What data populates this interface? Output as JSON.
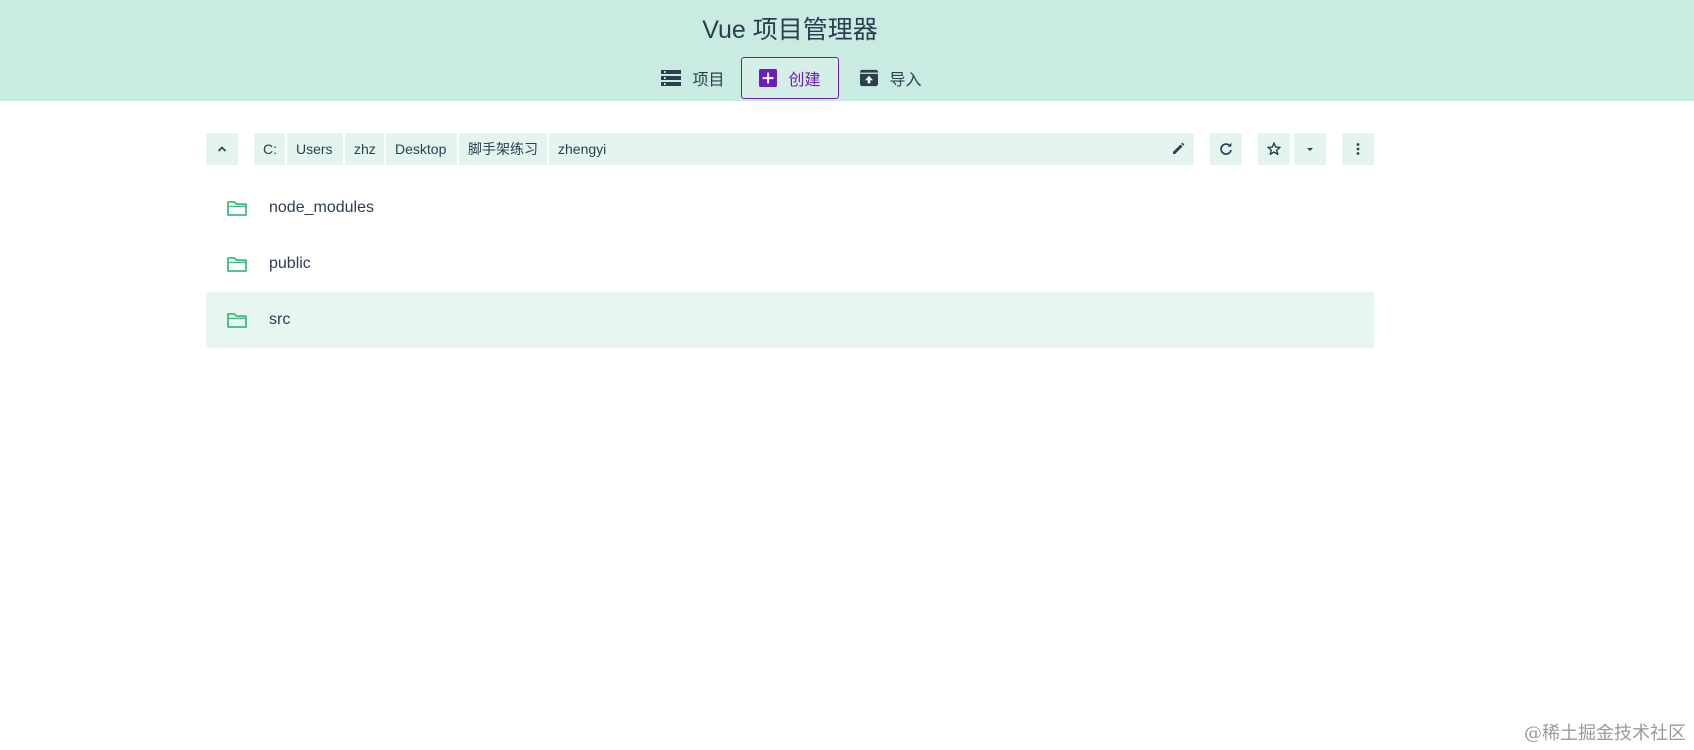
{
  "app": {
    "title": "Vue 项目管理器"
  },
  "tabs": [
    {
      "label": "项目",
      "icon": "list-icon"
    },
    {
      "label": "创建",
      "icon": "add-box-icon",
      "active": true
    },
    {
      "label": "导入",
      "icon": "unarchive-icon"
    }
  ],
  "toolbar": {
    "breadcrumb": [
      "C:",
      "Users",
      "zhz",
      "Desktop",
      "脚手架练习",
      "zhengyi"
    ],
    "icons": {
      "up": "chevron-up-icon",
      "edit": "pencil-icon",
      "refresh": "refresh-icon",
      "favorite": "star-outline-icon",
      "favorites_menu": "caret-down-icon",
      "more": "more-vertical-icon"
    }
  },
  "folders": [
    {
      "name": "node_modules",
      "selected": false
    },
    {
      "name": "public",
      "selected": false
    },
    {
      "name": "src",
      "selected": true
    }
  ],
  "colors": {
    "header_bg": "#c9ebe1",
    "accent": "#6a1fb8",
    "folder_icon": "#42b983",
    "toolbar_bg": "#e4f5ef",
    "text": "#2c3e50"
  },
  "watermark": "@稀土掘金技术社区"
}
